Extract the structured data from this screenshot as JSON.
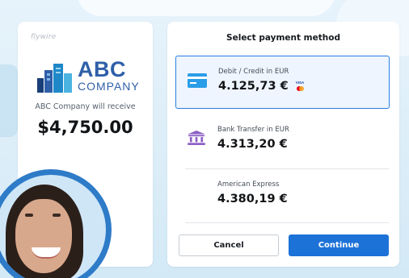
{
  "brand": {
    "provider": "flywire",
    "company_name_line1": "ABC",
    "company_name_line2": "COMPANY",
    "receive_text": "ABC Company will receive",
    "amount": "$4,750.00",
    "logo_colors": [
      "#1e88c9",
      "#2f5fa8",
      "#4bb3e0",
      "#1a3f78"
    ]
  },
  "panel": {
    "title": "Select payment method",
    "options": [
      {
        "label": "Debit / Credit in EUR",
        "value": "4.125,73 €",
        "icon": "credit-card-icon",
        "selected": true,
        "badges": [
          "VISA",
          "mastercard"
        ]
      },
      {
        "label": "Bank Transfer in EUR",
        "value": "4.313,20 €",
        "icon": "bank-icon",
        "selected": false
      },
      {
        "label": "American Express",
        "value": "4.380,19 €",
        "icon": "none",
        "selected": false
      }
    ],
    "cancel_label": "Cancel",
    "continue_label": "Continue"
  },
  "colors": {
    "accent": "#1d72d8",
    "selected_bg": "#eef5fe",
    "icon_card": "#2a9de8",
    "icon_bank": "#8d5fc4"
  }
}
